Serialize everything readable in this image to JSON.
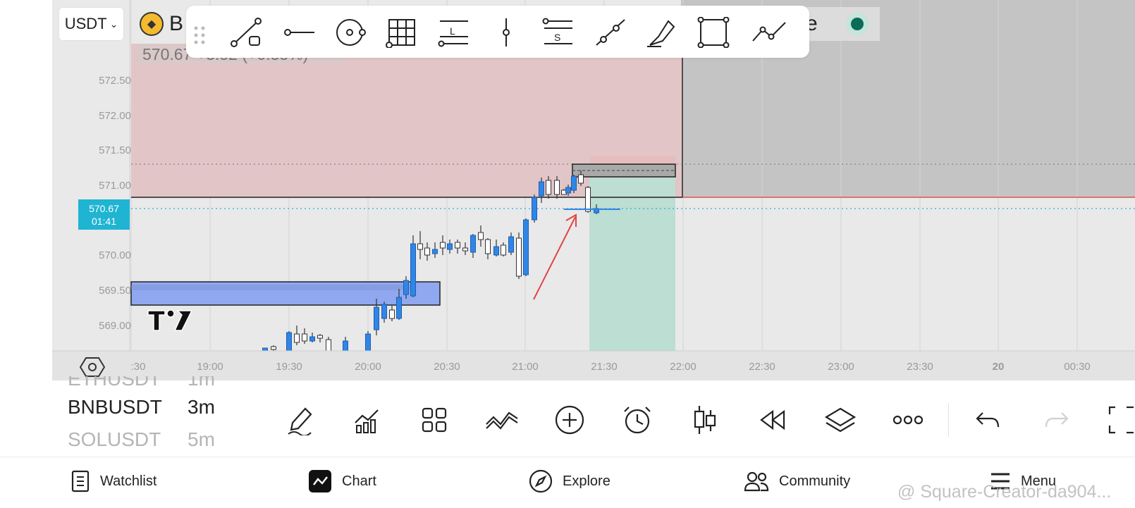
{
  "header": {
    "currency": "USDT",
    "symbol_letter": "B",
    "price_change": "570.67  +3.52 (+0.35%)",
    "status_text": "ce"
  },
  "chart": {
    "price_axis": [
      "572.50",
      "572.00",
      "571.50",
      "571.00",
      "570.00",
      "569.50",
      "569.00"
    ],
    "current_price": "570.67",
    "countdown": "01:41",
    "time_axis": [
      ":30",
      "19:00",
      "19:30",
      "20:00",
      "20:30",
      "21:00",
      "21:30",
      "22:00",
      "22:30",
      "23:00",
      "23:30",
      "20",
      "00:30"
    ]
  },
  "drawing_toolbar": {
    "tools": [
      "drag-handle-icon",
      "trend-line-icon",
      "horizontal-ray-icon",
      "circle-icon",
      "grid-icon",
      "long-position-icon",
      "vertical-line-icon",
      "short-position-icon",
      "parallel-channel-icon",
      "highlighter-icon",
      "rectangle-icon",
      "path-icon"
    ],
    "long_label": "L",
    "short_label": "S"
  },
  "symbol_picker": {
    "items": [
      {
        "symbol": "ETHUSDT",
        "interval": "1m"
      },
      {
        "symbol": "BNBUSDT",
        "interval": "3m"
      },
      {
        "symbol": "SOLUSDT",
        "interval": "5m"
      }
    ]
  },
  "bottom_toolbar": [
    "draw-icon",
    "indicators-icon",
    "layouts-icon",
    "patterns-icon",
    "add-icon",
    "alert-icon",
    "candles-icon",
    "replay-icon",
    "layers-icon",
    "more-icon",
    "undo-icon",
    "redo-icon",
    "fullscreen-icon"
  ],
  "nav": {
    "watchlist": "Watchlist",
    "chart": "Chart",
    "explore": "Explore",
    "community": "Community",
    "menu": "Menu"
  },
  "watermark": "@ Square-Creator-da904...",
  "colors": {
    "bull": "#2f86e6",
    "bear": "#ffffff",
    "price_tag": "#1fb4d2",
    "stop_zone": "#e1c5c7",
    "target_zone": "#bcded3",
    "demand_zone": "#8fa8f0",
    "status_dot": "#0b6b57"
  }
}
